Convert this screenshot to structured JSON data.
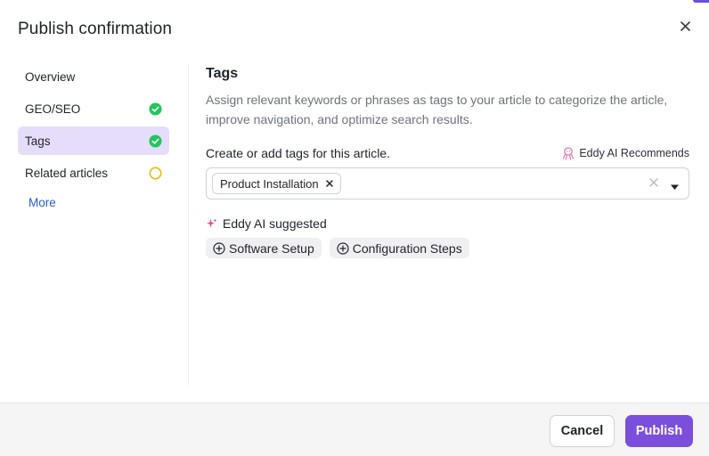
{
  "dialog": {
    "title": "Publish confirmation"
  },
  "sidebar": {
    "items": [
      {
        "label": "Overview",
        "status": "none"
      },
      {
        "label": "GEO/SEO",
        "status": "complete"
      },
      {
        "label": "Tags",
        "status": "complete",
        "active": true
      },
      {
        "label": "Related articles",
        "status": "pending"
      }
    ],
    "more_label": "More"
  },
  "tags_section": {
    "title": "Tags",
    "description": "Assign relevant keywords or phrases as tags to your article to categorize the article, improve navigation, and optimize search results.",
    "input_label": "Create or add tags for this article.",
    "ai_recommend_label": "Eddy AI Recommends",
    "selected_tags": [
      "Product Installation"
    ],
    "suggested_label": "Eddy AI suggested",
    "suggested_tags": [
      "Software Setup",
      "Configuration Steps"
    ]
  },
  "footer": {
    "cancel_label": "Cancel",
    "publish_label": "Publish"
  },
  "colors": {
    "accent": "#7b4fdc",
    "active_nav_bg": "#e6ddfa",
    "complete": "#22c55e",
    "pending": "#f5b800",
    "link": "#2a5bd7"
  },
  "icons": {
    "close": "close-icon",
    "complete": "check-circle-icon",
    "pending": "circle-outline-icon",
    "ai_recommend": "octopus-icon",
    "ai_suggest": "sparkle-icon",
    "add": "plus-circle-icon",
    "remove": "x-icon",
    "dropdown": "caret-down-icon"
  }
}
